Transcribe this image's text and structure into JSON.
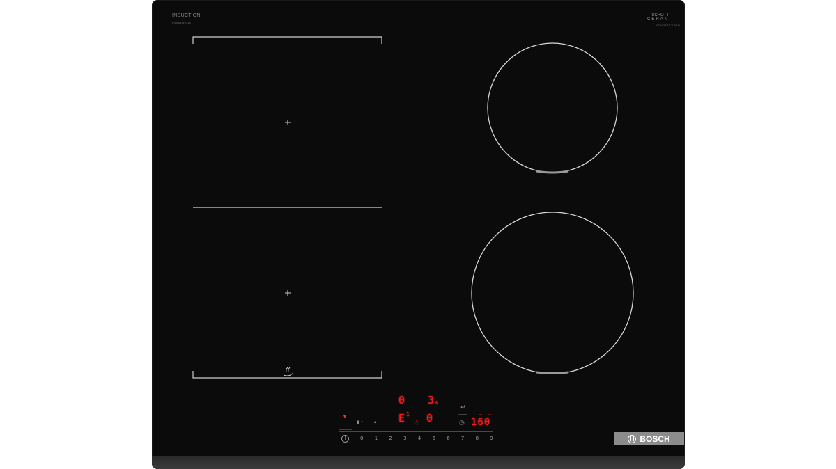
{
  "panel": {
    "induction_label": "INDUCTION",
    "model_code": "PVS631HC1E",
    "schott_line1": "SCHOTT",
    "schott_line2": "CERAN",
    "schott_line3": "SCHOTT CERAN"
  },
  "brand": {
    "name": "BOSCH"
  },
  "display": {
    "zone_a_level": "0",
    "zone_a_timer": "3",
    "zone_a_timer_unit": "s",
    "zone_b_level": "E",
    "zone_b_level_sup": "1",
    "zone_b_value": "0",
    "temperature": "160",
    "favorite_icon": "star-icon",
    "clock_icon": "clock-icon"
  },
  "power_scale": [
    "0",
    "1",
    "2",
    "3",
    "4",
    "5",
    "6",
    "7",
    "8",
    "9"
  ],
  "icons": {
    "flex_zone_plus_top": "plus-icon",
    "flex_zone_plus_bottom": "plus-icon",
    "pan_sensor": "frying-pan-sensor-icon",
    "power": "power-icon",
    "wifi": "wifi-icon"
  },
  "colors": {
    "glass": "#0b0b0b",
    "zone_lines": "#cfcfcf",
    "display_red": "#ff1a1a",
    "brand_plate": "#8c8c8c"
  }
}
